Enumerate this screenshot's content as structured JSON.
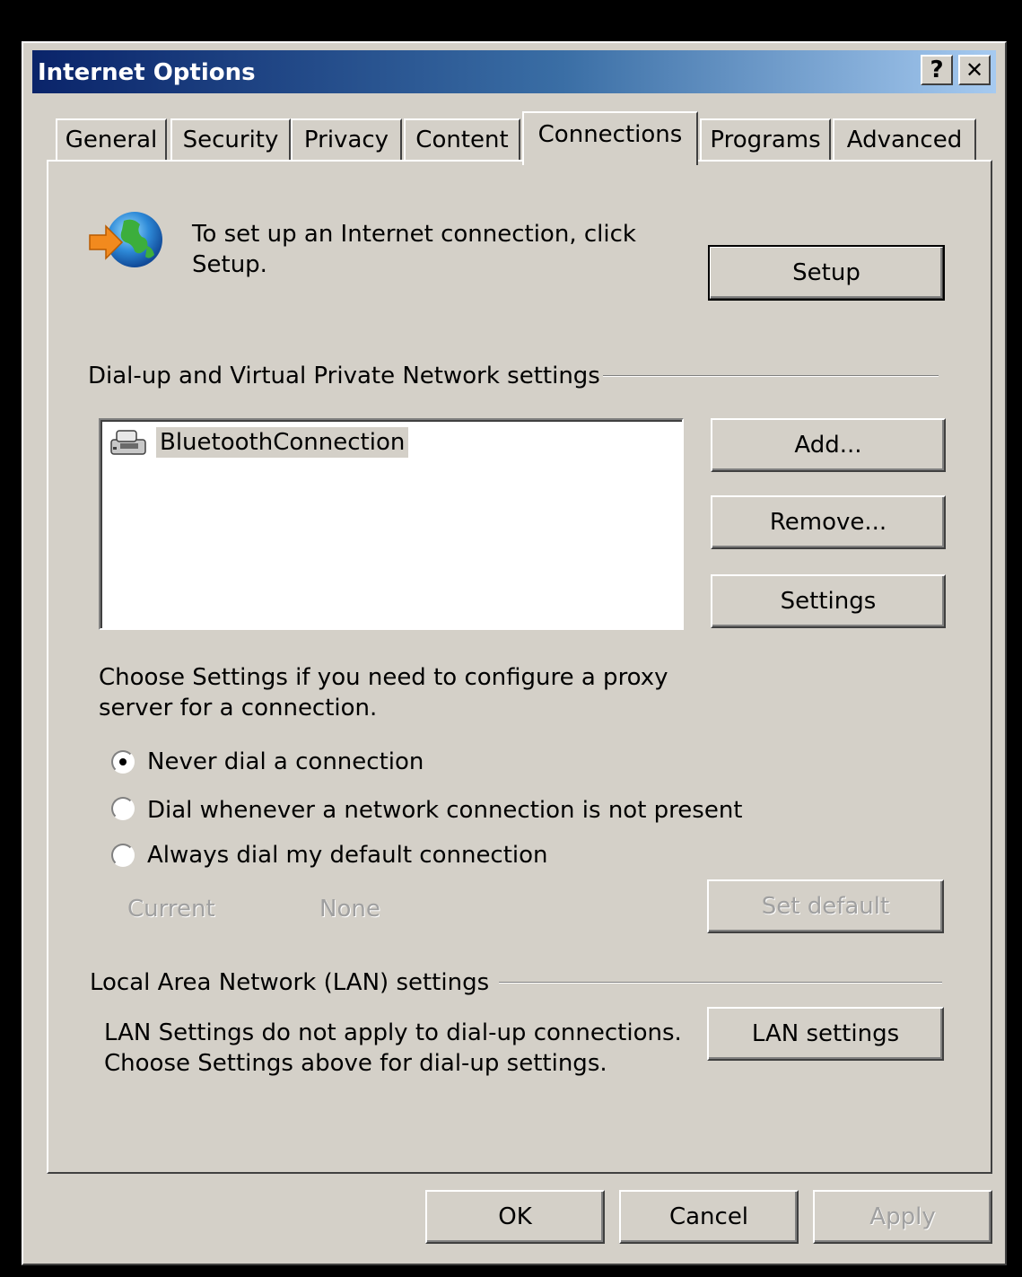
{
  "window": {
    "title": "Internet Options",
    "help_button": "?",
    "close_button": "✕"
  },
  "tabs": [
    {
      "label": "General"
    },
    {
      "label": "Security"
    },
    {
      "label": "Privacy"
    },
    {
      "label": "Content"
    },
    {
      "label": "Connections",
      "active": true
    },
    {
      "label": "Programs"
    },
    {
      "label": "Advanced"
    }
  ],
  "setup": {
    "text_line1": "To set up an Internet connection, click",
    "text_line2": "Setup.",
    "button": "Setup"
  },
  "dialup": {
    "heading": "Dial-up and Virtual Private Network settings",
    "connections": [
      "BluetoothConnection"
    ],
    "add_button": "Add...",
    "remove_button": "Remove...",
    "settings_button": "Settings",
    "proxy_text_line1": "Choose Settings if you need to configure a proxy",
    "proxy_text_line2": "server for a connection.",
    "options": [
      {
        "label": "Never dial a connection",
        "selected": true
      },
      {
        "label": "Dial whenever a network connection is not present",
        "selected": false
      },
      {
        "label": "Always dial my default connection",
        "selected": false
      }
    ],
    "current_label": "Current",
    "current_value": "None",
    "set_default_button": "Set default"
  },
  "lan": {
    "heading": "Local Area Network (LAN) settings",
    "text_line1": "LAN Settings do not apply to dial-up connections.",
    "text_line2": "Choose Settings above for dial-up settings.",
    "button": "LAN settings"
  },
  "footer": {
    "ok": "OK",
    "cancel": "Cancel",
    "apply": "Apply"
  },
  "colors": {
    "face": "#d4d0c8",
    "title_start": "#0a246a",
    "title_end": "#a6caf0",
    "disabled_text": "#a0a0a0"
  }
}
